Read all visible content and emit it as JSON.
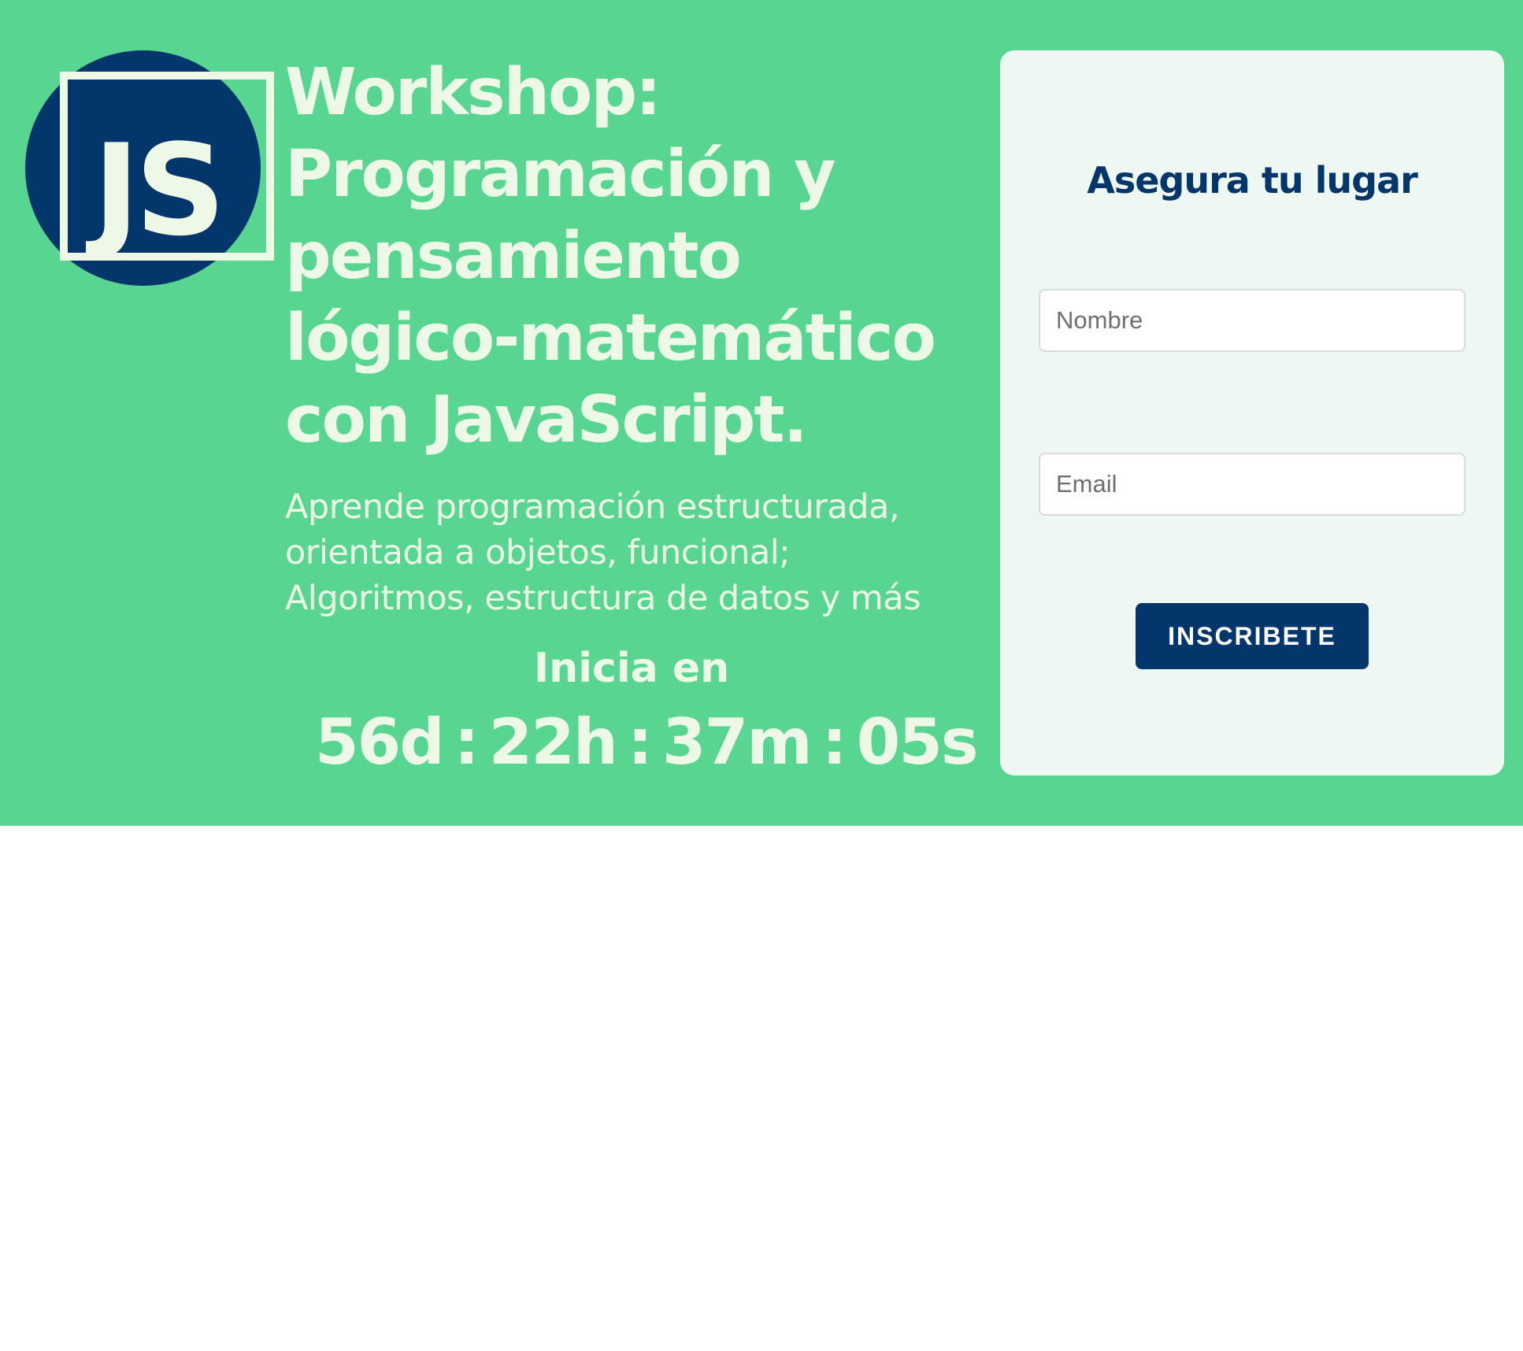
{
  "colors": {
    "hero_background": "#58d591",
    "accent_navy": "#03366a",
    "hero_text": "#eef8e6",
    "card_background": "#eef8f2"
  },
  "logo": {
    "text": "JS",
    "icon": "javascript-logo-icon"
  },
  "hero": {
    "title": "Workshop: Programación y pensamiento lógico-matemático con JavaScript.",
    "description": "Aprende programación estructurada, orientada a objetos, funcional; Algoritmos, estructura de datos y más",
    "starts_label": "Inicia en"
  },
  "countdown": {
    "days": "56d",
    "hours": "22h",
    "minutes": "37m",
    "seconds": "05s",
    "separator": ":"
  },
  "form": {
    "title": "Asegura tu lugar",
    "name_placeholder": "Nombre",
    "name_value": "",
    "email_placeholder": "Email",
    "email_value": "",
    "submit_label": "INSCRIBETE"
  }
}
